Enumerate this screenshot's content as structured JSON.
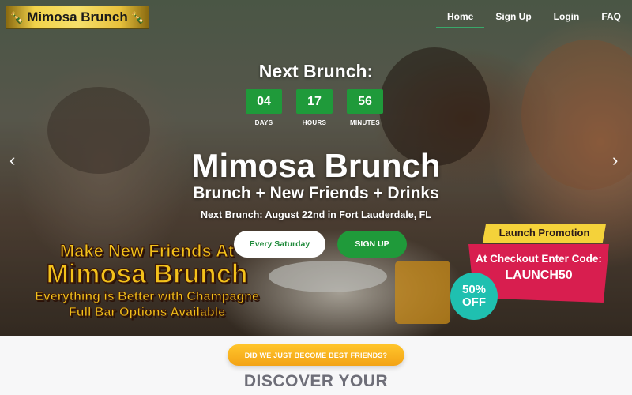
{
  "header": {
    "logo_text": "Mimosa Brunch",
    "nav": [
      {
        "label": "Home",
        "active": true
      },
      {
        "label": "Sign Up",
        "active": false
      },
      {
        "label": "Login",
        "active": false
      },
      {
        "label": "FAQ",
        "active": false
      }
    ]
  },
  "hero": {
    "countdown_title": "Next Brunch:",
    "countdown": [
      {
        "value": "04",
        "unit": "DAYS"
      },
      {
        "value": "17",
        "unit": "HOURS"
      },
      {
        "value": "56",
        "unit": "MINUTES"
      }
    ],
    "title": "Mimosa Brunch",
    "subtitle": "Brunch + New Friends + Drinks",
    "next_date": "Next Brunch: August 22nd in Fort Lauderdale, FL",
    "schedule_button": "Every Saturday",
    "signup_button": "SIGN UP",
    "prev_arrow": "‹",
    "next_arrow": "›"
  },
  "promo_image": {
    "line1": "Make New Friends At",
    "line2": "Mimosa Brunch",
    "line3": "Everything is Better with Champagne",
    "line4": "Full Bar Options Available",
    "badge_title": "Launch Promotion",
    "badge_line": "At Checkout Enter Code:",
    "badge_code": "LAUNCH50",
    "discount_value": "50%",
    "discount_label": "OFF"
  },
  "lower": {
    "cta_button": "DID WE JUST BECOME BEST FRIENDS?",
    "heading": "DISCOVER YOUR"
  },
  "colors": {
    "brand_green": "#1f9a3a",
    "promo_yellow": "#f3c21b",
    "promo_red": "#d81e4f",
    "promo_teal": "#1fc0b0",
    "cta_orange": "#f3a316"
  }
}
